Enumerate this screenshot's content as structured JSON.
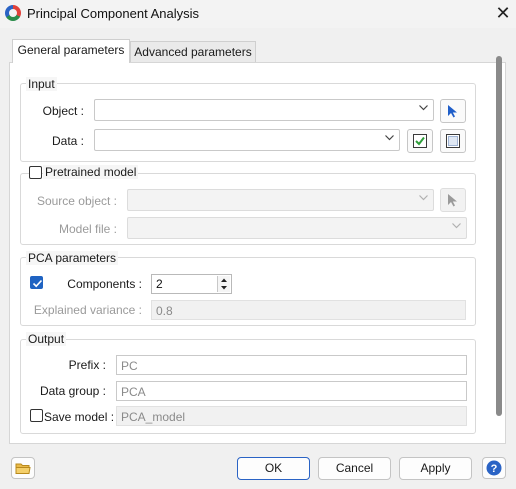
{
  "window": {
    "title": "Principal Component Analysis"
  },
  "tabs": [
    {
      "label": "General parameters",
      "active": true
    },
    {
      "label": "Advanced parameters",
      "active": false
    }
  ],
  "input": {
    "group_title": "Input",
    "object_label": "Object :",
    "object_value": "",
    "data_label": "Data :",
    "data_value": ""
  },
  "pretrained": {
    "group_title": "Pretrained model",
    "checked": false,
    "source_label": "Source object :",
    "source_value": "",
    "model_file_label": "Model file :",
    "model_file_value": ""
  },
  "pca": {
    "group_title": "PCA parameters",
    "components_checked": true,
    "components_label": "Components :",
    "components_value": "2",
    "explained_label": "Explained variance :",
    "explained_value": "0.8"
  },
  "output": {
    "group_title": "Output",
    "prefix_label": "Prefix :",
    "prefix_value": "PC",
    "data_group_label": "Data group :",
    "data_group_value": "PCA",
    "save_model_label": "Save model :",
    "save_model_checked": false,
    "save_model_value": "PCA_model"
  },
  "footer": {
    "ok": "OK",
    "cancel": "Cancel",
    "apply": "Apply"
  },
  "icons": {
    "app": "pca-app-icon",
    "close": "close-icon",
    "pick": "arrow-cursor-icon",
    "select_all": "check-all-icon",
    "clear": "empty-box-icon",
    "load": "folder-icon",
    "help": "help-icon"
  },
  "colors": {
    "accent": "#1f63c2",
    "help": "#2a63c5"
  }
}
